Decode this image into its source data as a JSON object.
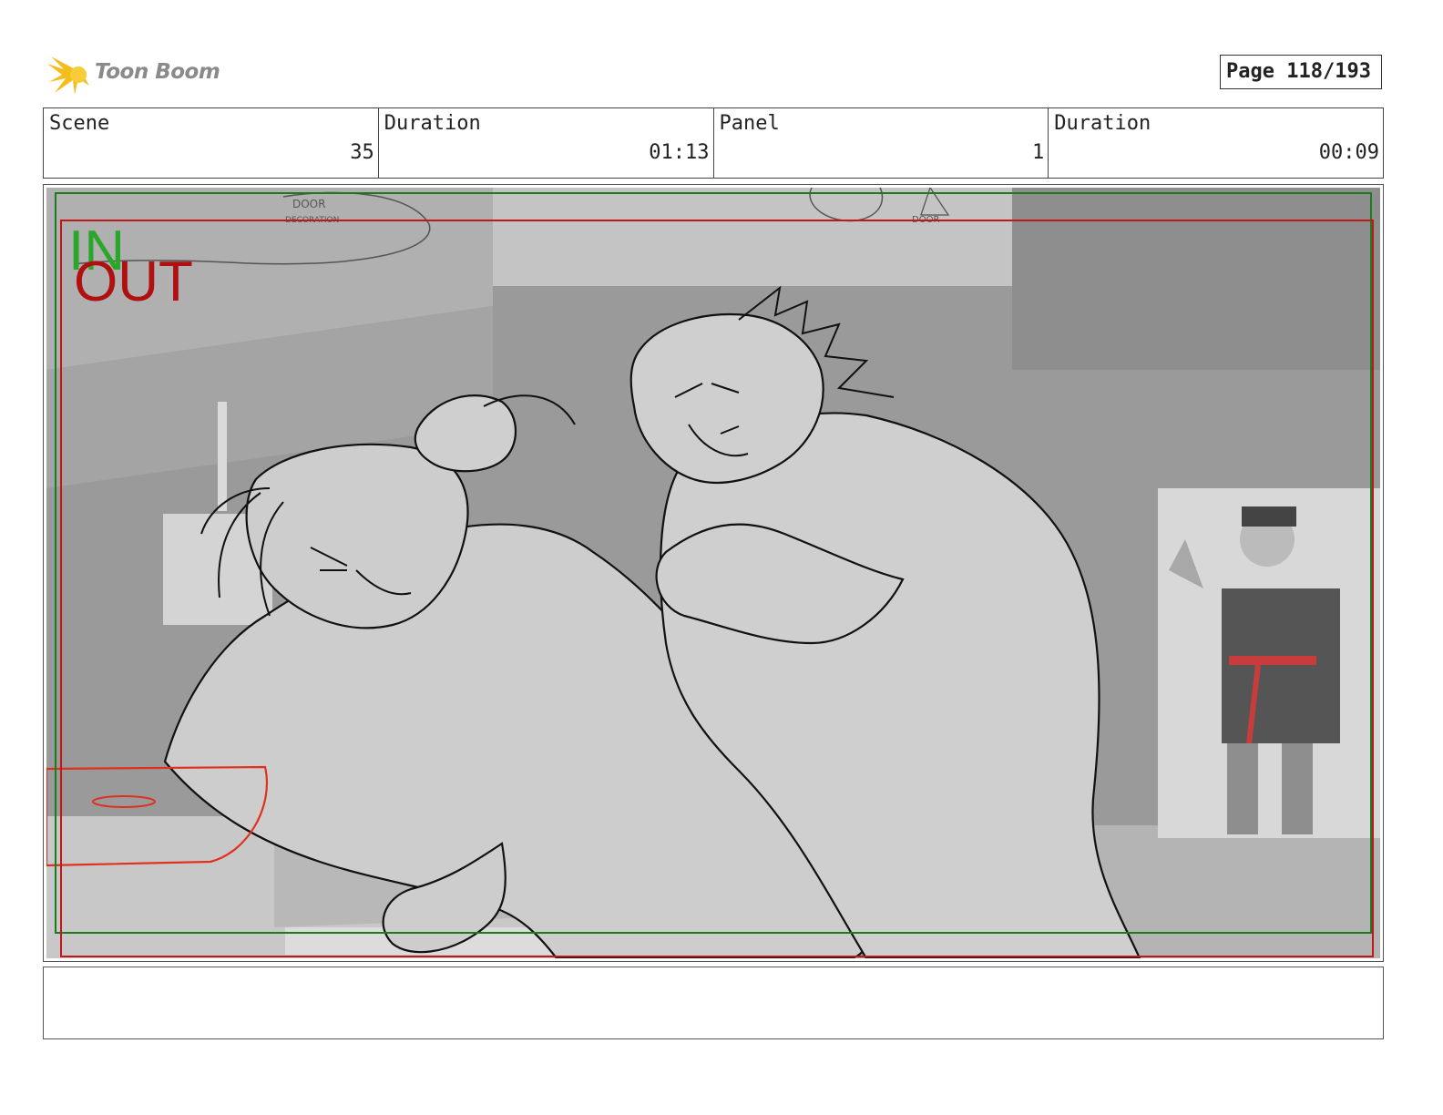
{
  "brand": {
    "name": "Toon Boom",
    "logo_color": "#f2b81c"
  },
  "page": {
    "label": "Page 118/193"
  },
  "header": {
    "scene_label": "Scene",
    "scene_value": "35",
    "scene_duration_label": "Duration",
    "scene_duration_value": "01:13",
    "panel_label": "Panel",
    "panel_value": "1",
    "panel_duration_label": "Duration",
    "panel_duration_value": "00:09"
  },
  "panel": {
    "in_label": "IN",
    "out_label": "OUT",
    "in_color": "#2aa62a",
    "out_color": "#b01010",
    "sketch_notes": [
      "DOOR",
      "DECORATION",
      "DOOR"
    ]
  },
  "notes": {
    "text": ""
  }
}
